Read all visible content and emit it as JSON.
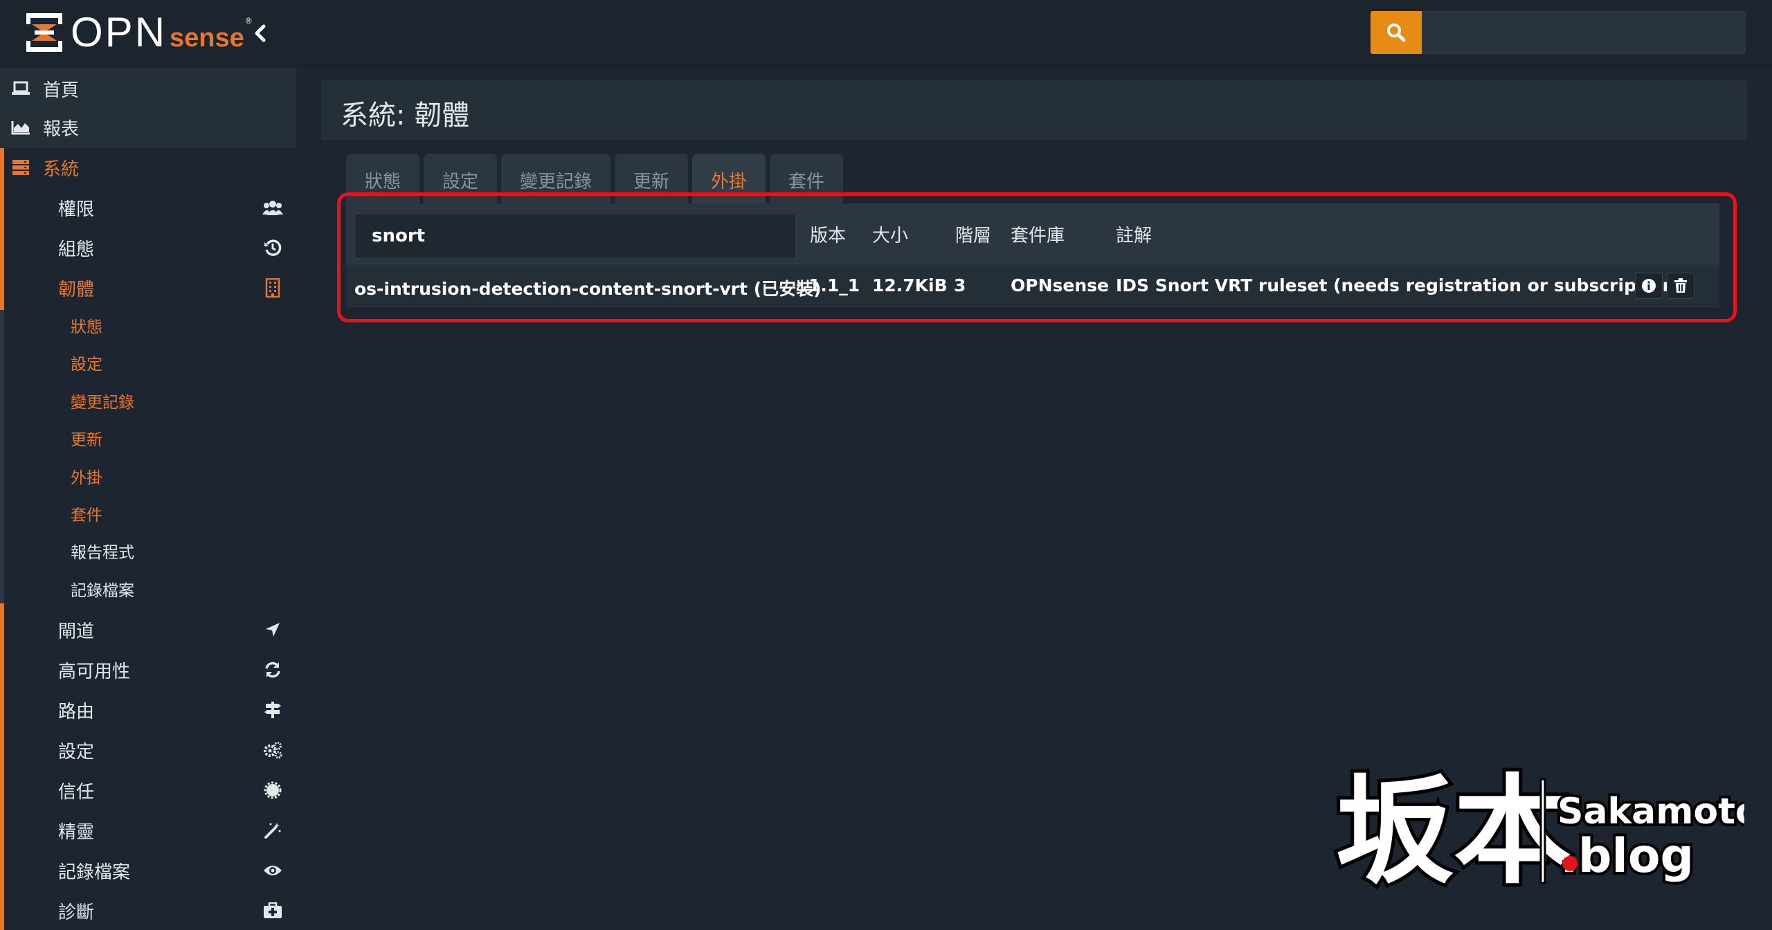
{
  "brand": {
    "name_main": "OPN",
    "name_suffix": "sense",
    "registered": "®"
  },
  "search": {
    "placeholder": "",
    "value": ""
  },
  "sidebar": {
    "top_items": [
      {
        "label": "首頁",
        "icon": "laptop-icon"
      },
      {
        "label": "報表",
        "icon": "area-chart-icon"
      }
    ],
    "section": {
      "label": "系統",
      "icon": "server-icon"
    },
    "items": [
      {
        "label": "權限",
        "icon": "users-icon"
      },
      {
        "label": "組態",
        "icon": "history-icon"
      },
      {
        "label": "韌體",
        "icon": "building-icon",
        "active": true
      },
      {
        "label": "閘道",
        "icon": "location-arrow-icon"
      },
      {
        "label": "高可用性",
        "icon": "refresh-icon"
      },
      {
        "label": "路由",
        "icon": "map-signs-icon"
      },
      {
        "label": "設定",
        "icon": "cogs-icon"
      },
      {
        "label": "信任",
        "icon": "certificate-icon"
      },
      {
        "label": "精靈",
        "icon": "magic-wand-icon"
      },
      {
        "label": "記錄檔案",
        "icon": "eye-icon"
      },
      {
        "label": "診斷",
        "icon": "medkit-icon"
      }
    ],
    "firmware_subitems": [
      "狀態",
      "設定",
      "變更記錄",
      "更新",
      "外掛",
      "套件",
      "報告程式",
      "記錄檔案"
    ]
  },
  "page": {
    "title": "系統: 韌體"
  },
  "tabs": [
    {
      "label": "狀態"
    },
    {
      "label": "設定"
    },
    {
      "label": "變更記錄"
    },
    {
      "label": "更新"
    },
    {
      "label": "外掛",
      "active": true
    },
    {
      "label": "套件"
    }
  ],
  "plugins_table": {
    "filter_value": "snort",
    "columns": [
      "版本",
      "大小",
      "階層",
      "套件庫",
      "註解"
    ],
    "rows": [
      {
        "name": "os-intrusion-detection-content-snort-vrt (已安裝)",
        "version": "1.1_1",
        "size": "12.7KiB",
        "tier": "3",
        "repository": "OPNsense",
        "comment": "IDS Snort VRT ruleset (needs registration or subscription)"
      }
    ]
  },
  "colors": {
    "accent": "#e8772e",
    "search_button": "#e58b16",
    "highlight_box": "#e8121c",
    "background": "#1d2630"
  },
  "watermark": {
    "kanji": "坂本",
    "line1": "Sakamoto",
    "line2": ".blog"
  }
}
